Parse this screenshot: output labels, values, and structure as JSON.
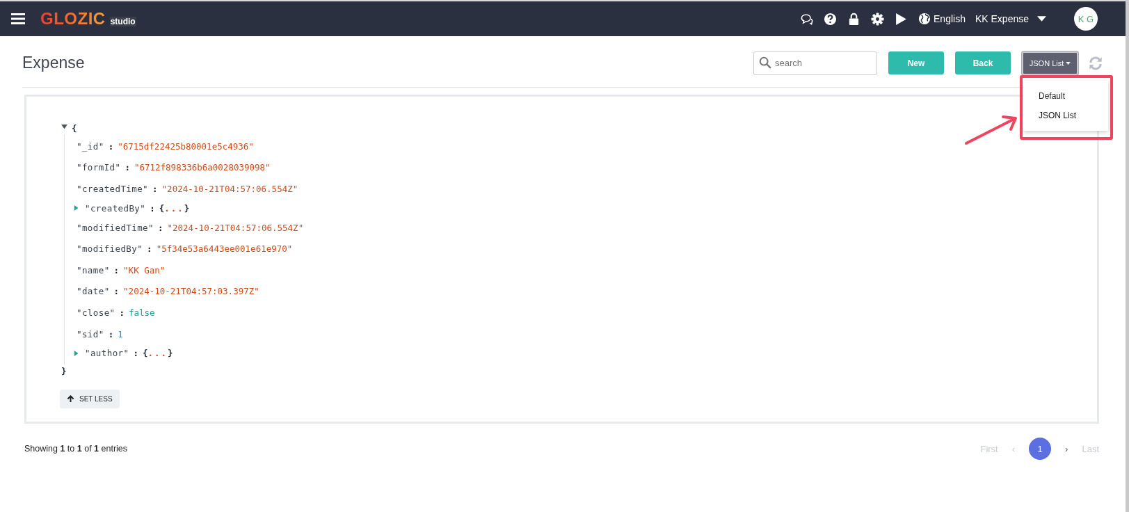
{
  "header": {
    "logo": "GLOZIC",
    "logo_sub": "studio",
    "language": "English",
    "app_menu": "KK Expense",
    "avatar": "K G"
  },
  "page": {
    "title": "Expense",
    "search": {
      "placeholder": "search"
    },
    "buttons": [
      "New",
      "Back"
    ],
    "view_dropdown": {
      "label": "JSON List",
      "expanded": true,
      "options": [
        {
          "label": "Default",
          "selected": false
        },
        {
          "label": "JSON List",
          "selected": true
        }
      ]
    }
  },
  "json_view": {
    "open": "{",
    "close": "}",
    "expanded": true,
    "rows": [
      {
        "kind": "string",
        "key": "\"_id\"",
        "sep": ":",
        "value": "\"6715df22425b80001e5c4936\""
      },
      {
        "kind": "string",
        "key": "\"formId\"",
        "sep": ":",
        "value": "\"6712f898336b6a0028039098\""
      },
      {
        "kind": "string",
        "key": "\"createdTime\"",
        "sep": ":",
        "value": "\"2024-10-21T04:57:06.554Z\""
      },
      {
        "kind": "object",
        "key": "\"createdBy\"",
        "sep": ":",
        "open": "{",
        "value": "...",
        "close": "}",
        "expanded": false
      },
      {
        "kind": "string",
        "key": "\"modifiedTime\"",
        "sep": ":",
        "value": "\"2024-10-21T04:57:06.554Z\""
      },
      {
        "kind": "string",
        "key": "\"modifiedBy\"",
        "sep": ":",
        "value": "\"5f34e53a6443ee001e61e970\""
      },
      {
        "kind": "string",
        "key": "\"name\"",
        "sep": ":",
        "value": "\"KK Gan\""
      },
      {
        "kind": "string",
        "key": "\"date\"",
        "sep": ":",
        "value": "\"2024-10-21T04:57:03.397Z\""
      },
      {
        "kind": "boolean",
        "key": "\"close\"",
        "sep": ":",
        "value": "false"
      },
      {
        "kind": "number",
        "key": "\"sid\"",
        "sep": ":",
        "value": "1"
      },
      {
        "kind": "object",
        "key": "\"author\"",
        "sep": ":",
        "open": "{",
        "value": "...",
        "close": "}",
        "expanded": false
      }
    ],
    "toggle_button": "SET LESS"
  },
  "footer": {
    "info": "Showing **1** to **1** of **1** entries",
    "pagination": [
      {
        "label": "First",
        "selected": false,
        "disabled": true
      },
      {
        "label": "‹",
        "selected": false,
        "disabled": true
      },
      {
        "label": "1",
        "selected": true,
        "disabled": false
      },
      {
        "label": "›",
        "selected": false,
        "disabled": false
      },
      {
        "label": "Last",
        "selected": false,
        "disabled": true
      }
    ]
  }
}
